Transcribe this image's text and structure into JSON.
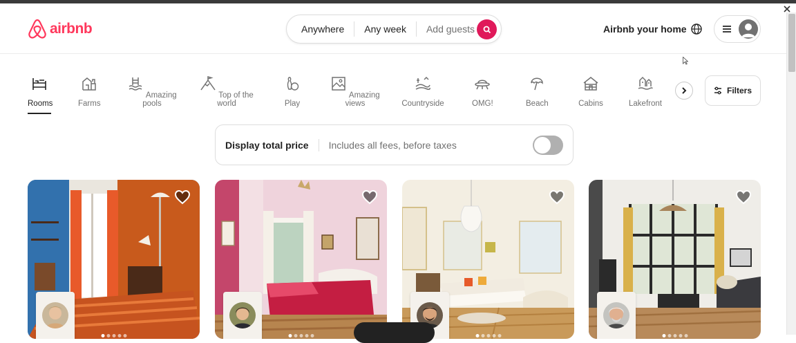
{
  "header": {
    "logo_text": "airbnb",
    "search": {
      "where": "Anywhere",
      "when": "Any week",
      "guests_placeholder": "Add guests"
    },
    "host_link": "Airbnb your home"
  },
  "categories": [
    {
      "label": "Rooms",
      "icon": "bunk-bed-icon",
      "active": true
    },
    {
      "label": "Farms",
      "icon": "barn-icon"
    },
    {
      "label": "Amazing pools",
      "icon": "pool-icon"
    },
    {
      "label": "Top of the world",
      "icon": "mountain-flag-icon"
    },
    {
      "label": "Play",
      "icon": "bowling-icon"
    },
    {
      "label": "Amazing views",
      "icon": "picture-frame-icon"
    },
    {
      "label": "Countryside",
      "icon": "countryside-icon"
    },
    {
      "label": "OMG!",
      "icon": "ufo-icon"
    },
    {
      "label": "Beach",
      "icon": "umbrella-icon"
    },
    {
      "label": "Cabins",
      "icon": "cabin-icon"
    },
    {
      "label": "Lakefront",
      "icon": "lakefront-icon"
    }
  ],
  "filters_label": "Filters",
  "price_display": {
    "title": "Display total price",
    "subtitle": "Includes all fees, before taxes",
    "enabled": false
  },
  "colors": {
    "brand": "#ff385c",
    "search_button": "#e0195a"
  }
}
